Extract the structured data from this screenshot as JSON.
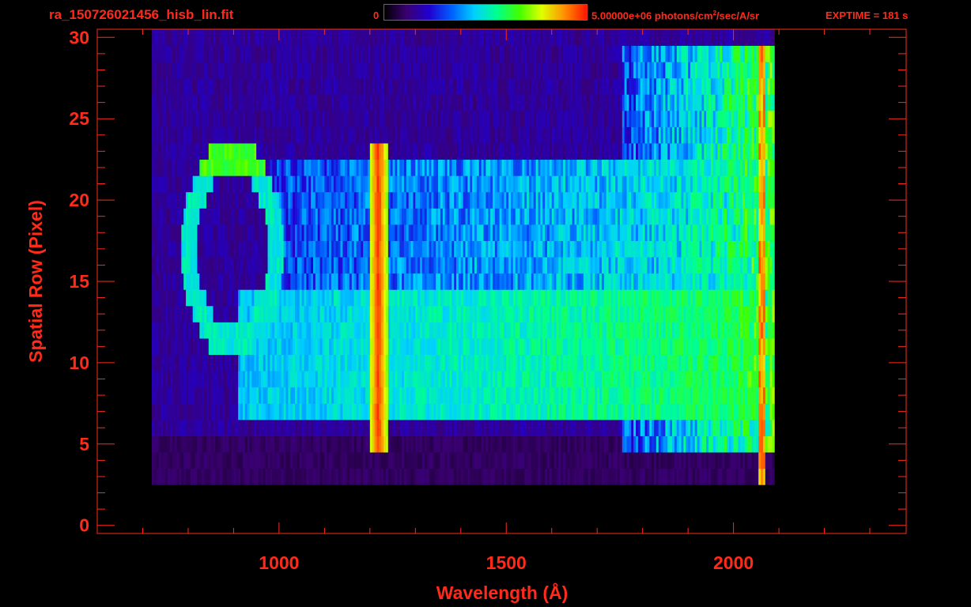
{
  "header": {
    "file_title": "ra_150726021456_hisb_lin.fit",
    "colorbar_min_label": "0",
    "colorbar_max_label_main": "5.00000e+06 photons/cm",
    "colorbar_max_label_sup": "2",
    "colorbar_max_label_tail": "/sec/A/sr",
    "exptime_label": "EXPTIME = 181 s"
  },
  "colors": {
    "axis": "#ff2a1a",
    "background": "#000000",
    "colormap": [
      "#000000",
      "#3a0070",
      "#2000d0",
      "#0060ff",
      "#00d0ff",
      "#00ff90",
      "#40ff00",
      "#e0ff00",
      "#ff9000",
      "#ff1500"
    ]
  },
  "chart_data": {
    "type": "heatmap",
    "title": "ra_150726021456_hisb_lin.fit",
    "xlabel": "Wavelength (Å)",
    "ylabel": "Spatial Row (Pixel)",
    "xlim": [
      600,
      2380
    ],
    "ylim": [
      -0.5,
      30.5
    ],
    "x_ticks": [
      1000,
      1500,
      2000
    ],
    "y_ticks": [
      0,
      5,
      10,
      15,
      20,
      25,
      30
    ],
    "x_minor_step": 100,
    "y_minor_step": 1,
    "grid": false,
    "data_extent_x": [
      780,
      2090
    ],
    "detector_lit_rows": [
      3,
      30
    ],
    "colorbar": {
      "min": 0,
      "max": 5000000,
      "units": "photons/cm^2/sec/A/sr"
    },
    "features": [
      {
        "kind": "continuum_band",
        "x_range": [
          810,
          2060
        ],
        "rows": [
          7,
          15
        ],
        "level": 0.45
      },
      {
        "kind": "upper_band",
        "x_range": [
          780,
          2060
        ],
        "rows": [
          15,
          23
        ],
        "level": 0.3
      },
      {
        "kind": "lyman_alpha_line",
        "x_center": 1216,
        "x_width": 40,
        "rows": [
          5,
          23
        ],
        "level": 0.95
      },
      {
        "kind": "ring_source",
        "x_center": 895,
        "row_center": 17,
        "x_radius": 100,
        "row_radius": 6,
        "level": 0.5
      },
      {
        "kind": "red_edge",
        "x_center": 2060,
        "rows": [
          3,
          29
        ],
        "level": 0.8
      }
    ]
  }
}
